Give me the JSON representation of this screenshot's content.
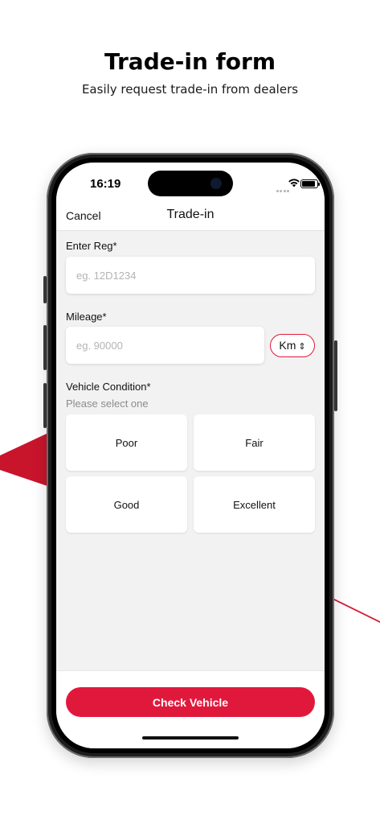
{
  "hero": {
    "title": "Trade-in form",
    "subtitle": "Easily request trade-in from dealers"
  },
  "status_bar": {
    "time": "16:19",
    "icons": [
      "cellular-icon",
      "wifi-icon",
      "battery-icon"
    ]
  },
  "navbar": {
    "cancel_label": "Cancel",
    "title": "Trade-in"
  },
  "form": {
    "reg": {
      "label": "Enter Reg*",
      "placeholder": "eg. 12D1234",
      "value": ""
    },
    "mileage": {
      "label": "Mileage*",
      "placeholder": "eg. 90000",
      "value": "",
      "unit": "Km"
    },
    "condition": {
      "label": "Vehicle Condition*",
      "hint": "Please select one",
      "options": [
        "Poor",
        "Fair",
        "Good",
        "Excellent"
      ]
    }
  },
  "footer": {
    "submit_label": "Check Vehicle"
  },
  "colors": {
    "accent": "#e0193c",
    "screen_bg": "#f2f2f2",
    "frame": "#1d1d1f"
  }
}
